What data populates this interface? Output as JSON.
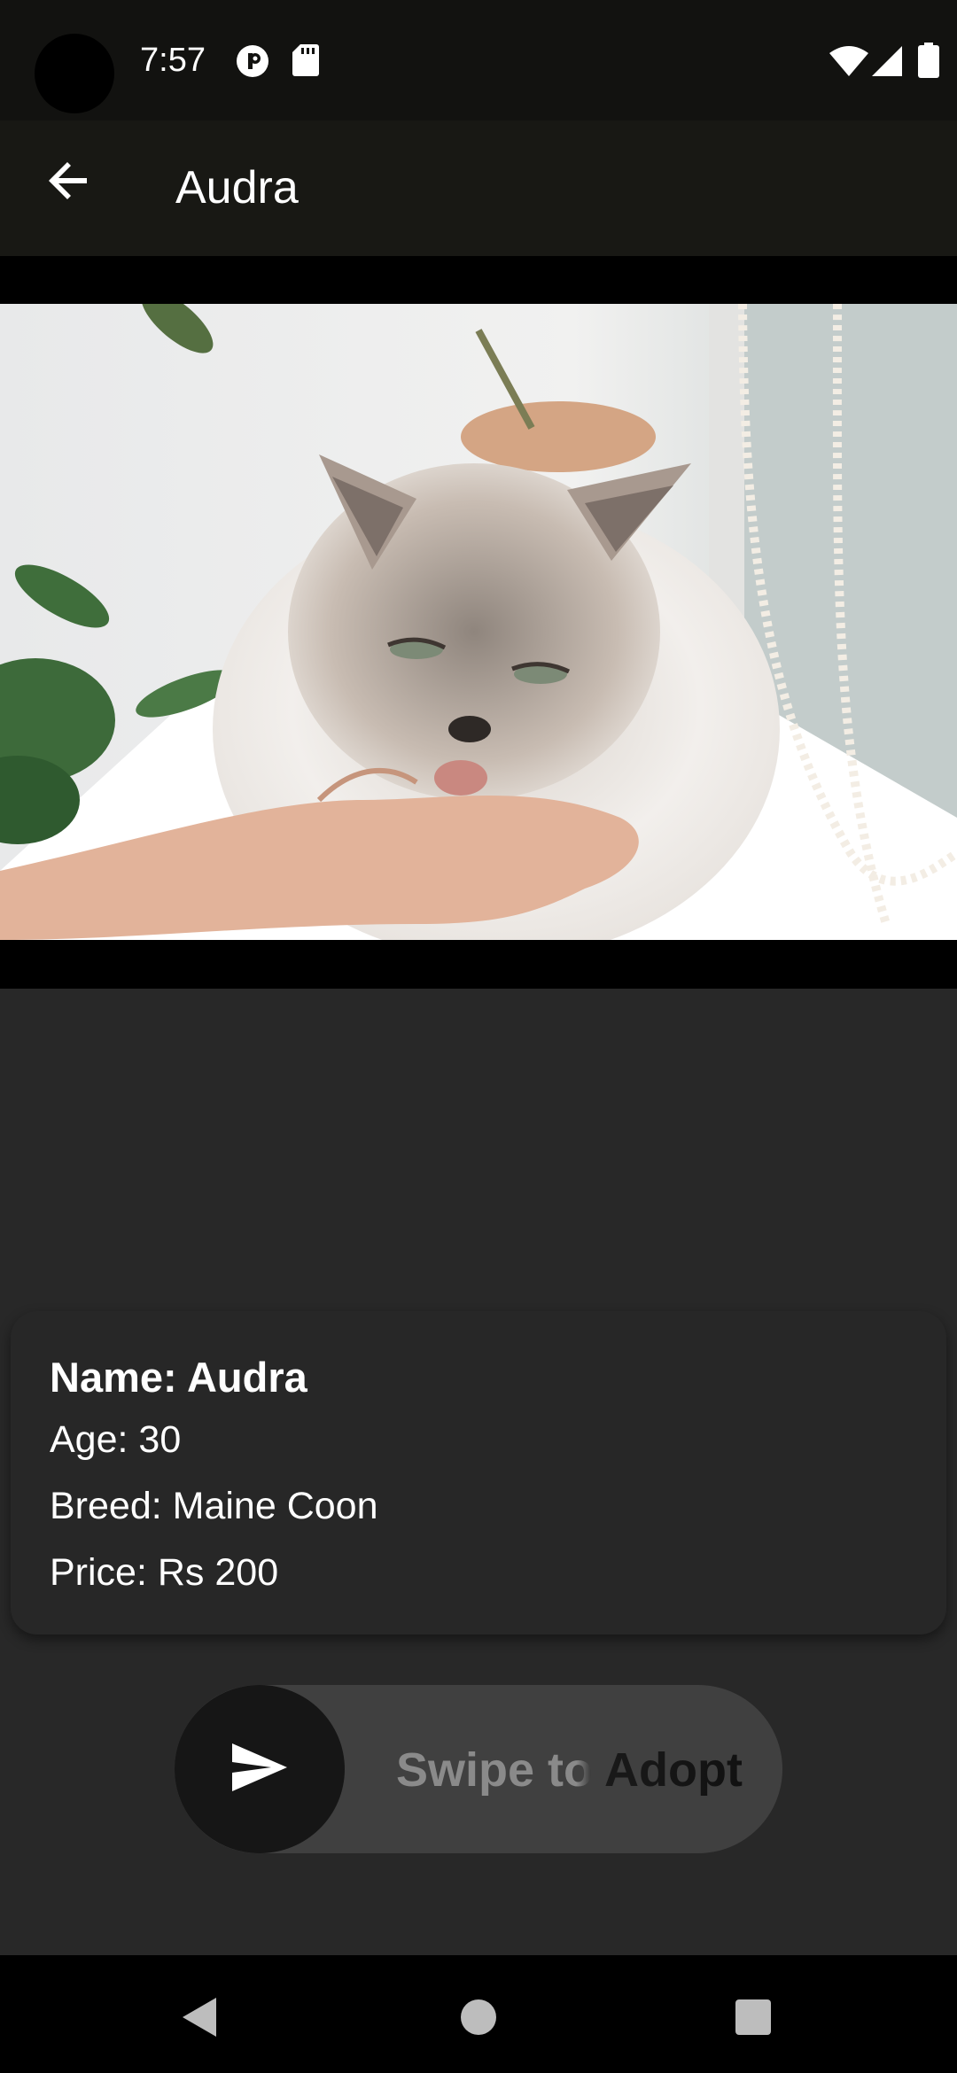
{
  "status_bar": {
    "time": "7:57",
    "icons": [
      "vpn-key-icon",
      "sd-card-icon",
      "wifi-icon",
      "cellular-signal-icon",
      "battery-icon"
    ]
  },
  "app_bar": {
    "title": "Audra",
    "back_icon": "arrow-left-icon"
  },
  "photo": {
    "subject": "fluffy white cat licking a hand on a windowsill"
  },
  "details": {
    "name": "Name: Audra",
    "age": "Age: 30",
    "breed": "Breed: Maine Coon",
    "price": "Price: Rs 200"
  },
  "swipe": {
    "label": "Swipe to Adopt",
    "icon": "send-icon"
  },
  "nav_bar": {
    "icons": [
      "back-triangle-icon",
      "home-circle-icon",
      "recents-square-icon"
    ]
  },
  "colors": {
    "background": "#282828",
    "status_bar": "#121210",
    "app_bar": "#181814",
    "card": "#272727",
    "swipe_track": "#404040",
    "swipe_knob": "#161616"
  }
}
